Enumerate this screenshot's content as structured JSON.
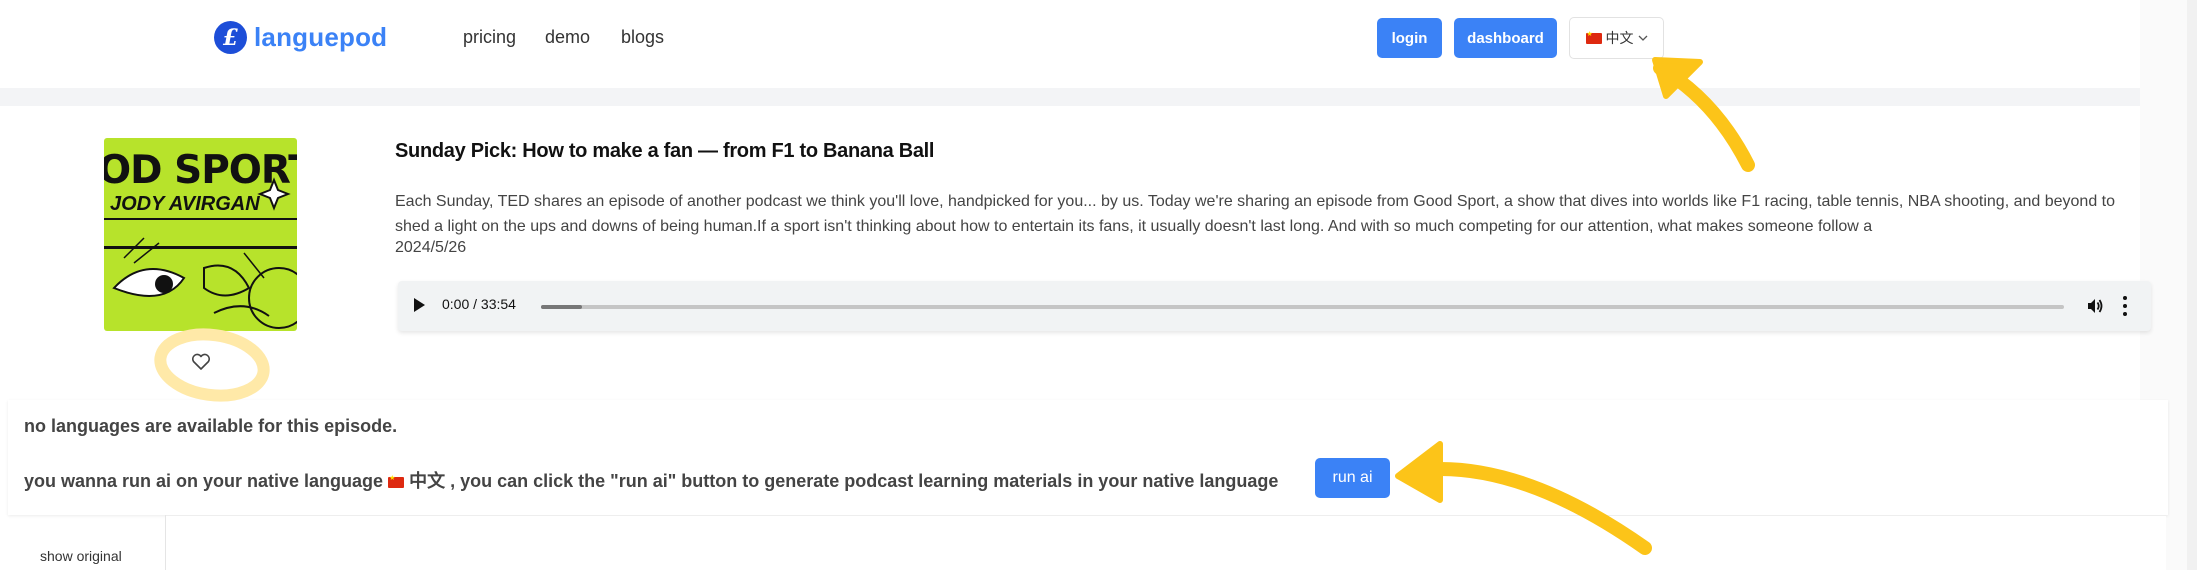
{
  "header": {
    "logo_glyph": "£",
    "logo_text": "languepod",
    "nav": [
      {
        "label": "pricing"
      },
      {
        "label": "demo"
      },
      {
        "label": "blogs"
      }
    ],
    "login_label": "login",
    "dashboard_label": "dashboard",
    "language_label": "中文"
  },
  "episode": {
    "cover_title": "OD SPORT",
    "cover_subtitle": "JODY AVIRGAN",
    "title": "Sunday Pick: How to make a fan — from F1 to Banana Ball",
    "description": "Each Sunday, TED shares an episode of another podcast we think you'll love, handpicked for you... by us. Today we're sharing an episode from Good Sport, a show that dives into worlds like F1 racing, table tennis, NBA shooting, and beyond to shed a light on the ups and downs of being human.If a sport isn't thinking about how to entertain its fans, it usually doesn't last long. And with so much competing for our attention, what makes someone follow a",
    "date": "2024/5/26",
    "player": {
      "time": "0:00 / 33:54",
      "progress": 0.027
    }
  },
  "info": {
    "no_languages": "no languages are available for this episode.",
    "run_msg_prefix": "you wanna run ai on your native language",
    "run_msg_lang": "中文",
    "run_msg_suffix": ", you can click the \"run ai\" button to generate podcast learning materials in your native language",
    "run_ai_label": "run ai",
    "show_original": "show original"
  },
  "colors": {
    "accent": "#3b82f6",
    "annotation": "#fcc419",
    "cover_bg": "#b7e32b"
  }
}
